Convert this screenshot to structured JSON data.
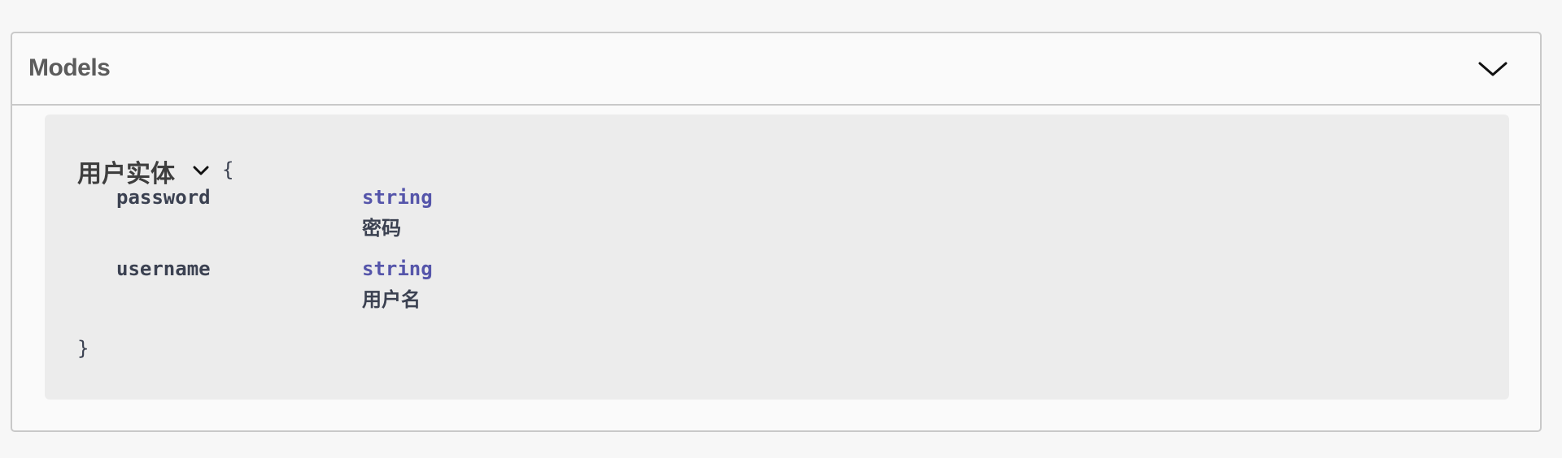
{
  "models": {
    "title": "Models",
    "toggle_icon": "chevron-down-icon"
  },
  "model": {
    "title": "用户实体",
    "toggle_icon": "chevron-down-icon",
    "open_brace": "{",
    "close_brace": "}",
    "properties": [
      {
        "name": "password",
        "type": "string",
        "description": "密码"
      },
      {
        "name": "username",
        "type": "string",
        "description": "用户名"
      }
    ]
  },
  "colors": {
    "type_color": "#5555aa",
    "text_color": "#3b4151",
    "border_color": "#c9c9c9",
    "model_bg": "#ececec"
  }
}
